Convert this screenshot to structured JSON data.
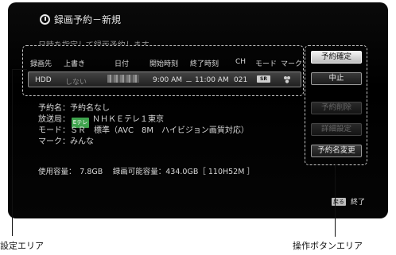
{
  "screen": {
    "title": "録画予約－新規",
    "subtitle": "日時を指定して録画予約します",
    "table_headers": [
      "録画先",
      "上書き",
      "日付",
      "開始時刻",
      "終了時刻",
      "CH",
      "モード",
      "マーク"
    ],
    "row": {
      "dest": "HDD",
      "overwrite": "しない",
      "start": "9:00 AM",
      "sep": "－",
      "end": "11:00 AM",
      "ch": "021",
      "mode_badge": "SR"
    },
    "info": {
      "name": "予約名：予約名なし",
      "station_label": "放送局：",
      "station_logo": "Eテレ",
      "station_name": "ＮＨＫＥテレ１東京",
      "mode": "モード：ＳＲ　標準（AVC　8M　ハイビジョン画質対応）",
      "mark": "マーク：みんな"
    },
    "usage": "使用容量：　7.8GB　 録画可能容量：434.0GB［ 110H52M ］",
    "buttons": [
      {
        "label": "予約確定",
        "state": "selected"
      },
      {
        "label": "中止",
        "state": "normal"
      },
      {
        "label": "予約削除",
        "state": "disabled"
      },
      {
        "label": "詳細設定",
        "state": "disabled"
      },
      {
        "label": "予約名変更",
        "state": "normal"
      }
    ],
    "back_key": "戻る",
    "end_label": "終了"
  },
  "captions": {
    "left": "設定エリア",
    "right": "操作ボタンエリア"
  },
  "colors": {
    "screen_bg": "#000000",
    "text": "#e0e0e0",
    "etele_green": "#3fa34d"
  }
}
